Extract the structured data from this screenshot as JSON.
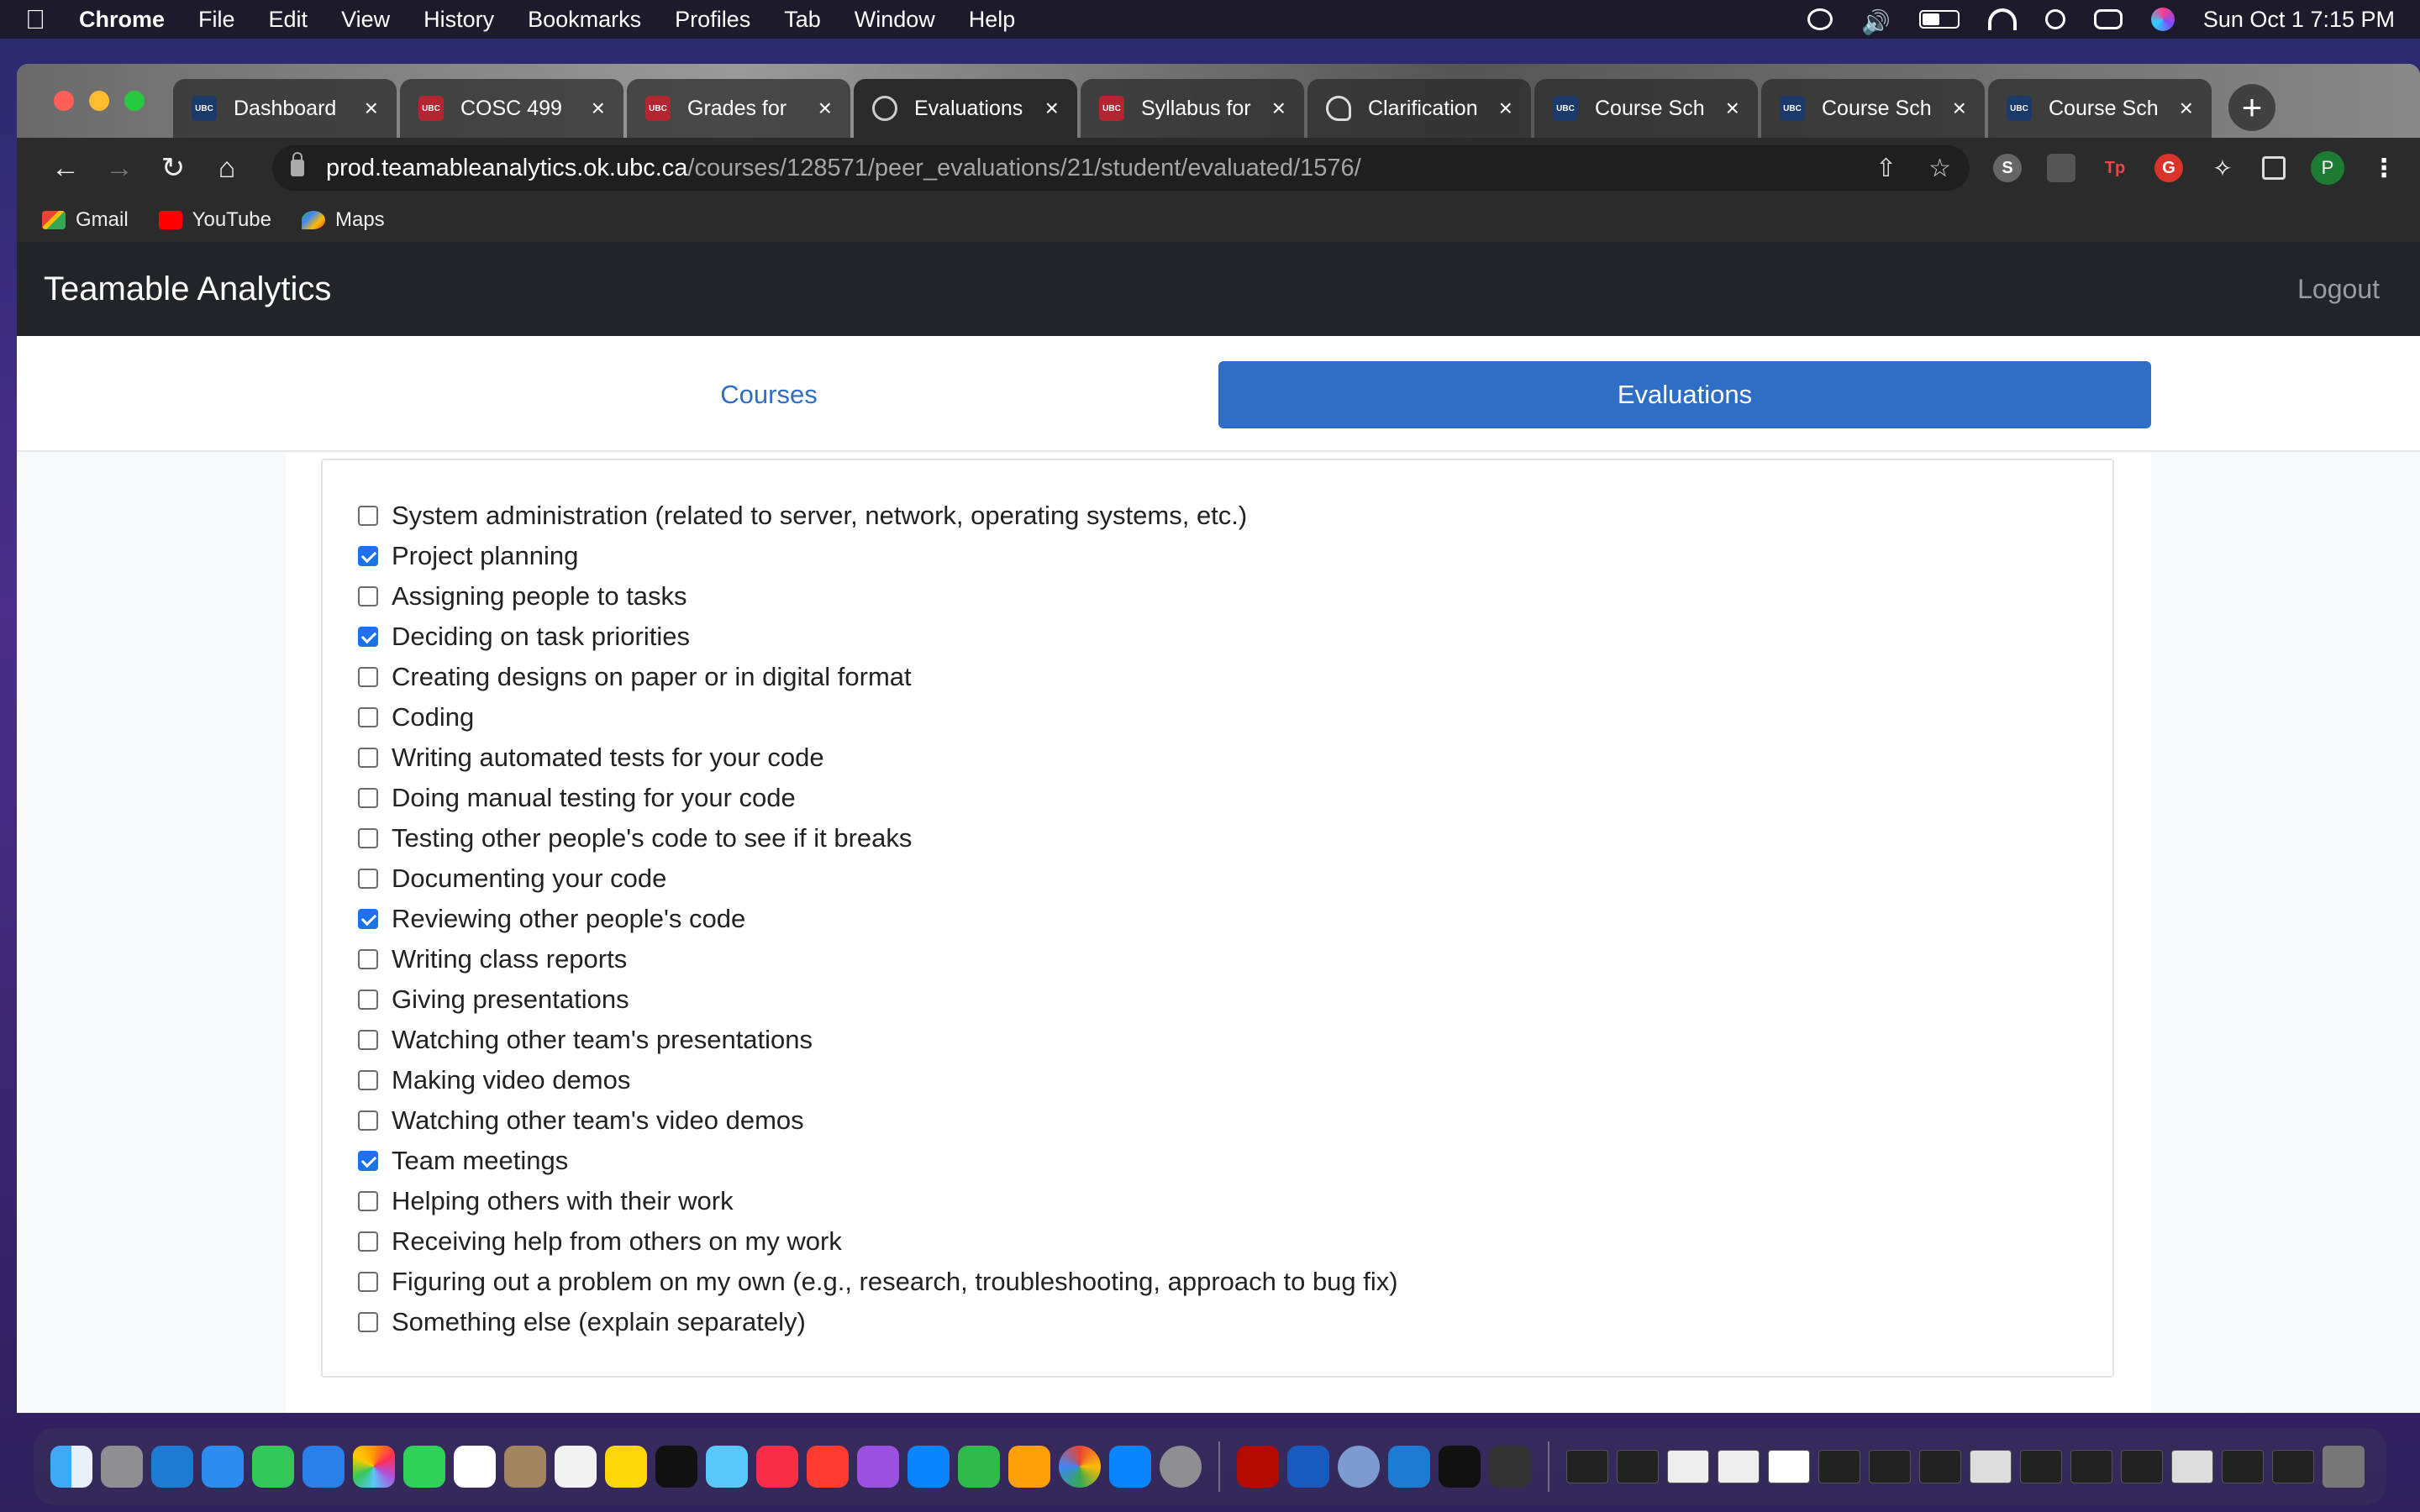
{
  "menubar": {
    "apple_icon": "",
    "app_name": "Chrome",
    "items": [
      "File",
      "Edit",
      "View",
      "History",
      "Bookmarks",
      "Profiles",
      "Tab",
      "Window",
      "Help"
    ],
    "clock": "Sun Oct 1  7:15 PM"
  },
  "tabs": [
    {
      "title": "Dashboard",
      "favicon": "UBC"
    },
    {
      "title": "COSC 499",
      "favicon": "UBC"
    },
    {
      "title": "Grades for",
      "favicon": "UBC"
    },
    {
      "title": "Evaluations",
      "favicon": "globe"
    },
    {
      "title": "Syllabus for",
      "favicon": "UBC"
    },
    {
      "title": "Clarification",
      "favicon": "ear"
    },
    {
      "title": "Course Sch",
      "favicon": "UBC"
    },
    {
      "title": "Course Sch",
      "favicon": "UBC"
    },
    {
      "title": "Course Sch",
      "favicon": "UBC"
    }
  ],
  "omnibox": {
    "host": "prod.teamableanalytics.ok.ubc.ca",
    "path": "/courses/128571/peer_evaluations/21/student/evaluated/1576/"
  },
  "bookmarks": [
    "Gmail",
    "YouTube",
    "Maps"
  ],
  "profile_initial": "P",
  "app": {
    "brand": "Teamable Analytics",
    "logout": "Logout",
    "nav": {
      "courses": "Courses",
      "evaluations": "Evaluations"
    }
  },
  "options": [
    {
      "label": "System administration (related to server, network, operating systems, etc.)",
      "checked": false
    },
    {
      "label": "Project planning",
      "checked": true
    },
    {
      "label": "Assigning people to tasks",
      "checked": false
    },
    {
      "label": "Deciding on task priorities",
      "checked": true
    },
    {
      "label": "Creating designs on paper or in digital format",
      "checked": false
    },
    {
      "label": "Coding",
      "checked": false
    },
    {
      "label": "Writing automated tests for your code",
      "checked": false
    },
    {
      "label": "Doing manual testing for your code",
      "checked": false
    },
    {
      "label": "Testing other people's code to see if it breaks",
      "checked": false
    },
    {
      "label": "Documenting your code",
      "checked": false
    },
    {
      "label": "Reviewing other people's code",
      "checked": true
    },
    {
      "label": "Writing class reports",
      "checked": false
    },
    {
      "label": "Giving presentations",
      "checked": false
    },
    {
      "label": "Watching other team's presentations",
      "checked": false
    },
    {
      "label": "Making video demos",
      "checked": false
    },
    {
      "label": "Watching other team's video demos",
      "checked": false
    },
    {
      "label": "Team meetings",
      "checked": true
    },
    {
      "label": "Helping others with their work",
      "checked": false
    },
    {
      "label": "Receiving help from others on my work",
      "checked": false
    },
    {
      "label": "Figuring out a problem on my own (e.g., research, troubleshooting, approach to bug fix)",
      "checked": false
    },
    {
      "label": "Something else (explain separately)",
      "checked": false
    }
  ],
  "colors": {
    "accent": "#2f6ec5",
    "navbar": "#212529",
    "checkbox": "#1a73e8"
  }
}
